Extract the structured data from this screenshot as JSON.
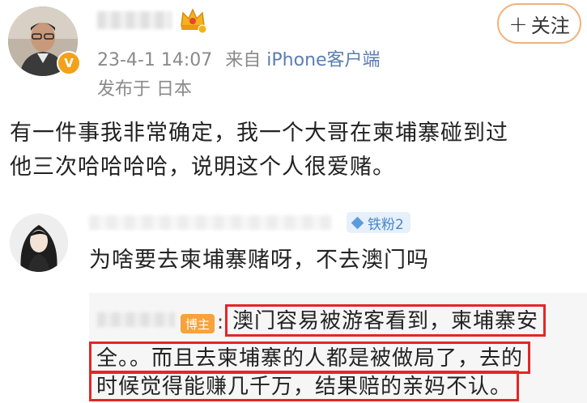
{
  "post": {
    "meta_time": "23-4-1 14:07",
    "meta_source_prefix": "来自",
    "meta_platform": "iPhone客户端",
    "location": "发布于 日本",
    "follow_label": "关注",
    "follow_plus": "+",
    "verified_badge": "V",
    "text_line1": "有一件事我非常确定，我一个大哥在柬埔寨碰到过",
    "text_line2": "他三次哈哈哈哈，说明这个人很爱赌。"
  },
  "comment": {
    "fan_badge": "铁粉2",
    "text": "为啥要去柬埔寨赌呀，不去澳门吗"
  },
  "reply": {
    "blogger_badge": "博主",
    "colon": ":",
    "line1": "澳门容易被游客看到，柬埔寨安",
    "line2": "全。。而且去柬埔寨的人都是被做局了，去的",
    "line3": "时候觉得能赚几千万，结果赔的亲妈不认。"
  },
  "colors": {
    "accent_orange": "#f2a21a",
    "platform_blue": "#5a7db3",
    "highlight_red": "#e32626",
    "fan_blue": "#4a86c8"
  },
  "icons": {
    "crown": "crown-icon",
    "verified": "verified-icon",
    "fan": "diamond-icon"
  }
}
